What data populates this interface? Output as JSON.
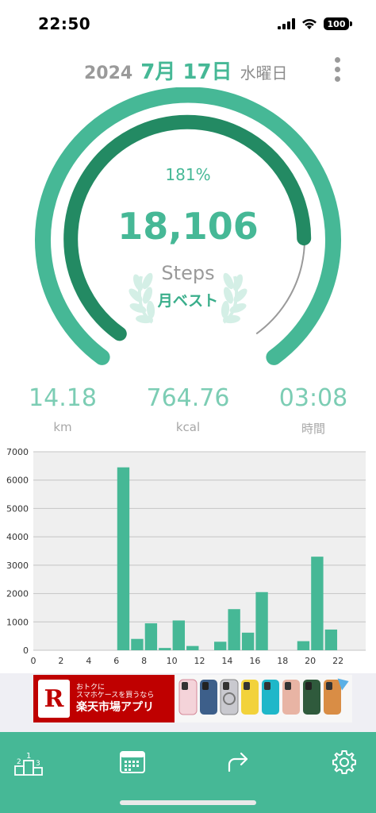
{
  "status_bar": {
    "time": "22:50",
    "battery": "100",
    "icons": [
      "cellular-signal-icon",
      "wifi-icon",
      "battery-icon"
    ]
  },
  "header": {
    "year": "2024",
    "month_day": "7月 17日",
    "weekday": "水曜日",
    "menu_icon": "more-vertical-icon"
  },
  "summary": {
    "goal_percent": "181%",
    "goal_progress": 1.81,
    "steps": "18,106",
    "steps_label": "Steps",
    "award": "月ベスト",
    "award_icon": "laurel-wreath-icon"
  },
  "stats": [
    {
      "value": "14.18",
      "unit": "km"
    },
    {
      "value": "764.76",
      "unit": "kcal"
    },
    {
      "value": "03:08",
      "unit": "時間"
    }
  ],
  "chart_data": {
    "type": "bar",
    "title": "",
    "xlabel": "",
    "ylabel": "",
    "x_ticks": [
      "0",
      "2",
      "4",
      "6",
      "8",
      "10",
      "12",
      "14",
      "16",
      "18",
      "20",
      "22"
    ],
    "y_ticks": [
      "0",
      "1000",
      "2000",
      "3000",
      "4000",
      "5000",
      "6000",
      "7000"
    ],
    "ylim": [
      0,
      7000
    ],
    "xlim": [
      0,
      24
    ],
    "hours": [
      0,
      1,
      2,
      3,
      4,
      5,
      6,
      7,
      8,
      9,
      10,
      11,
      12,
      13,
      14,
      15,
      16,
      17,
      18,
      19,
      20,
      21,
      22,
      23
    ],
    "values": [
      0,
      0,
      0,
      0,
      0,
      0,
      6450,
      400,
      950,
      80,
      1050,
      150,
      0,
      300,
      1450,
      620,
      2050,
      0,
      0,
      320,
      3300,
      730,
      0,
      0
    ],
    "bar_color": "#46b896",
    "grid": true
  },
  "ad": {
    "logo_text": "R",
    "line1": "おトクに",
    "line2": "スマホケースを買うなら",
    "line3": "楽天市場アプリ"
  },
  "tabbar": {
    "tabs": [
      {
        "name": "ranking",
        "icon": "podium-icon"
      },
      {
        "name": "calendar",
        "icon": "calendar-icon"
      },
      {
        "name": "share",
        "icon": "share-arrow-icon"
      },
      {
        "name": "settings",
        "icon": "gear-icon"
      }
    ]
  },
  "colors": {
    "accent": "#46b896",
    "accent_dark": "#238a63",
    "track_gray": "#9a9a9a",
    "text_gray": "#9a9a9a"
  }
}
